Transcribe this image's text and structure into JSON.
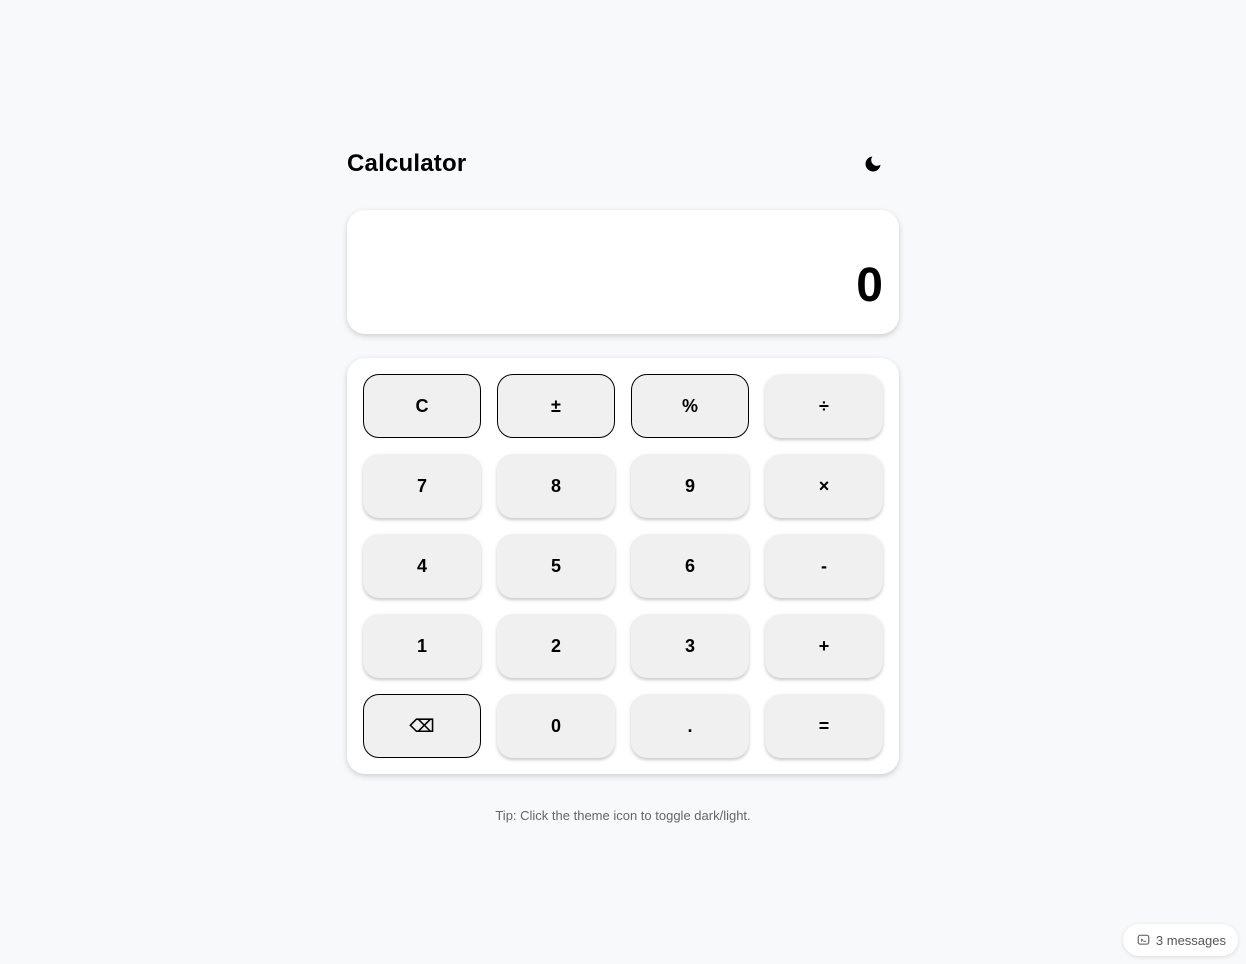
{
  "header": {
    "title": "Calculator",
    "theme_icon": "moon-icon"
  },
  "display": {
    "value": "0"
  },
  "keypad": {
    "keys": [
      {
        "label": "C",
        "name": "clear-button",
        "outlined": true
      },
      {
        "label": "±",
        "name": "toggle-sign-button",
        "outlined": true
      },
      {
        "label": "%",
        "name": "percent-button",
        "outlined": true
      },
      {
        "label": "÷",
        "name": "divide-button",
        "outlined": false
      },
      {
        "label": "7",
        "name": "digit-7-button",
        "outlined": false
      },
      {
        "label": "8",
        "name": "digit-8-button",
        "outlined": false
      },
      {
        "label": "9",
        "name": "digit-9-button",
        "outlined": false
      },
      {
        "label": "×",
        "name": "multiply-button",
        "outlined": false
      },
      {
        "label": "4",
        "name": "digit-4-button",
        "outlined": false
      },
      {
        "label": "5",
        "name": "digit-5-button",
        "outlined": false
      },
      {
        "label": "6",
        "name": "digit-6-button",
        "outlined": false
      },
      {
        "label": "-",
        "name": "subtract-button",
        "outlined": false
      },
      {
        "label": "1",
        "name": "digit-1-button",
        "outlined": false
      },
      {
        "label": "2",
        "name": "digit-2-button",
        "outlined": false
      },
      {
        "label": "3",
        "name": "digit-3-button",
        "outlined": false
      },
      {
        "label": "+",
        "name": "add-button",
        "outlined": false
      },
      {
        "label": "⌫",
        "name": "backspace-button",
        "outlined": true
      },
      {
        "label": "0",
        "name": "digit-0-button",
        "outlined": false
      },
      {
        "label": ".",
        "name": "decimal-button",
        "outlined": false
      },
      {
        "label": "=",
        "name": "equals-button",
        "outlined": false
      }
    ]
  },
  "tip": "Tip: Click the theme icon to toggle dark/light.",
  "messages": {
    "label": "3 messages",
    "icon": "chat-icon"
  }
}
